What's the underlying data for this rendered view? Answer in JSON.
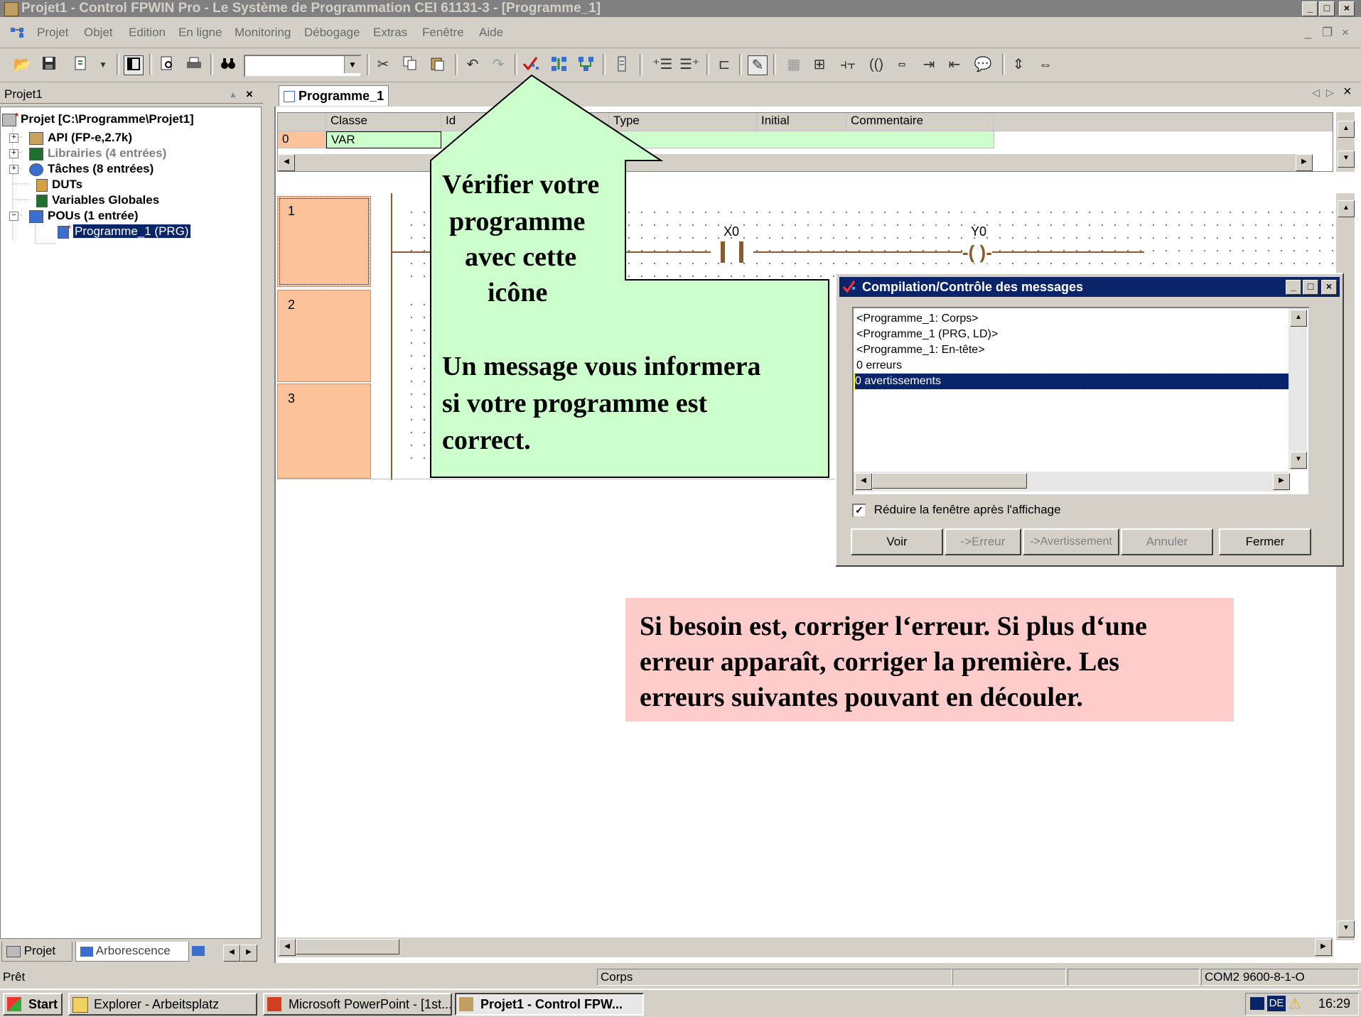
{
  "window": {
    "title": "Projet1 - Control FPWIN Pro - Le Système de Programmation CEI 61131-3 - [Programme_1]",
    "min": "_",
    "max": "□",
    "close": "×"
  },
  "menu": {
    "items": [
      "Projet",
      "Objet",
      "Edition",
      "En ligne",
      "Monitoring",
      "Débogage",
      "Extras",
      "Fenêtre",
      "Aide"
    ],
    "mdi_min": "_",
    "mdi_restore": "❐",
    "mdi_close": "×"
  },
  "left_panel": {
    "title": "Projet1",
    "close": "×",
    "tree": [
      {
        "label": "Projet [C:\\Programme\\Projet1]"
      },
      {
        "label": "API (FP-e,2.7k)"
      },
      {
        "label": "Librairies (4 entrées)"
      },
      {
        "label": "Tâches (8 entrées)"
      },
      {
        "label": "DUTs"
      },
      {
        "label": "Variables Globales"
      },
      {
        "label": "POUs (1 entrée)"
      },
      {
        "label": "Programme_1 (PRG)"
      }
    ],
    "tabs": [
      "Projet",
      "Arborescence"
    ]
  },
  "editor": {
    "tab_label": "Programme_1",
    "var_table": {
      "headers": [
        "Classe",
        "Id",
        "Type",
        "Initial",
        "Commentaire"
      ],
      "rows": [
        {
          "index": "0",
          "class": "VAR"
        }
      ]
    },
    "rungs": [
      "1",
      "2",
      "3"
    ],
    "contact_label": "X0",
    "coil_label": "Y0"
  },
  "callout_check": {
    "lines": [
      "Vérifier votre",
      "programme",
      "avec cette",
      "icône"
    ],
    "message_lines": [
      "Un message vous informera",
      "si votre programme est",
      "correct."
    ]
  },
  "callout_fix": {
    "lines": [
      "Si besoin est, corriger l‘erreur. Si plus d‘une",
      "erreur apparaît, corriger la première. Les",
      "erreurs suivantes pouvant en découler."
    ]
  },
  "dialog": {
    "title": "Compilation/Contrôle des messages",
    "messages": [
      "<Programme_1: Corps>",
      "<Programme_1 (PRG, LD)>",
      "<Programme_1: En-tête>",
      "0 erreurs",
      "0 avertissements"
    ],
    "selected_index": 4,
    "checkbox_label": "Réduire la fenêtre après l'affichage",
    "checkbox_checked": true,
    "buttons": [
      "Voir",
      "->Erreur",
      "->Avertissement",
      "Annuler",
      "Fermer"
    ]
  },
  "status": {
    "left": "Prêt",
    "middle": "Corps",
    "right": "COM2 9600-8-1-O"
  },
  "taskbar": {
    "start": "Start",
    "tasks": [
      "Explorer - Arbeitsplatz",
      "Microsoft PowerPoint - [1st...",
      "Projet1 - Control FPW..."
    ],
    "lang": "DE",
    "clock": "16:29"
  },
  "colors": {
    "rung_bg": "#fcc39a",
    "callout_green": "#ccffcc",
    "callout_pink": "#ffcccc",
    "dialog_title": "#0a246a",
    "selection": "#0a246a"
  }
}
